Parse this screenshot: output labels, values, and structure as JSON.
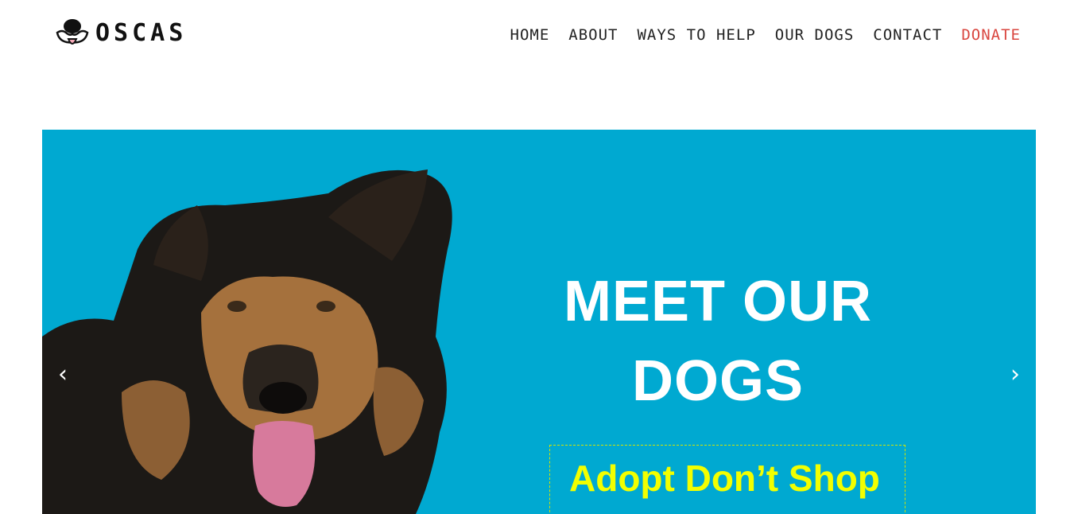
{
  "brand": {
    "name": "OSCAS",
    "logo_icon": "dog-face-icon"
  },
  "nav": {
    "items": [
      {
        "label": "HOME"
      },
      {
        "label": "ABOUT"
      },
      {
        "label": "WAYS TO HELP"
      },
      {
        "label": "OUR DOGS"
      },
      {
        "label": "CONTACT"
      },
      {
        "label": "DONATE"
      }
    ],
    "donate_color": "#d9463f"
  },
  "hero": {
    "background": "#00a9d1",
    "title_line1": "MEET OUR",
    "title_line2": "DOGS",
    "cta_label": "Adopt Don’t Shop",
    "cta_color": "#f2ff00",
    "prev_icon": "‹",
    "next_icon": "›"
  }
}
